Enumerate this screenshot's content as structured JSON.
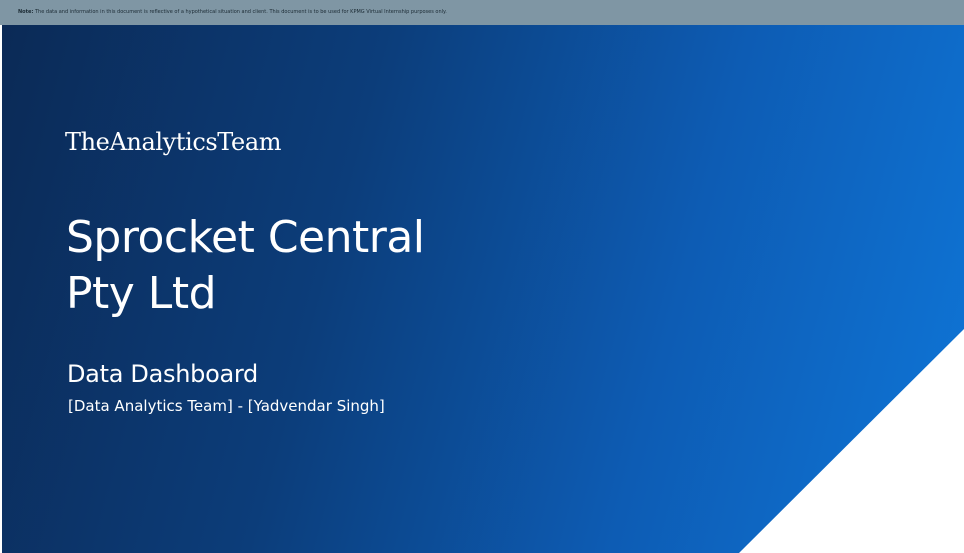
{
  "note_bar": {
    "label": "Note:",
    "text": "The data and information in this document is reflective of a hypothetical situation and client. This document is to be used for KPMG Virtual Internship purposes only."
  },
  "slide": {
    "brand": "TheAnalyticsTeam",
    "title_line1": "Sprocket Central",
    "title_line2": "Pty Ltd",
    "subtitle": "Data Dashboard",
    "byline": "[Data Analytics Team] - [Yadvendar Singh]"
  },
  "colors": {
    "note_bar_bg": "#7f96a4",
    "gradient_dark": "#0b2a56",
    "gradient_light": "#0f76d8",
    "text": "#ffffff"
  }
}
